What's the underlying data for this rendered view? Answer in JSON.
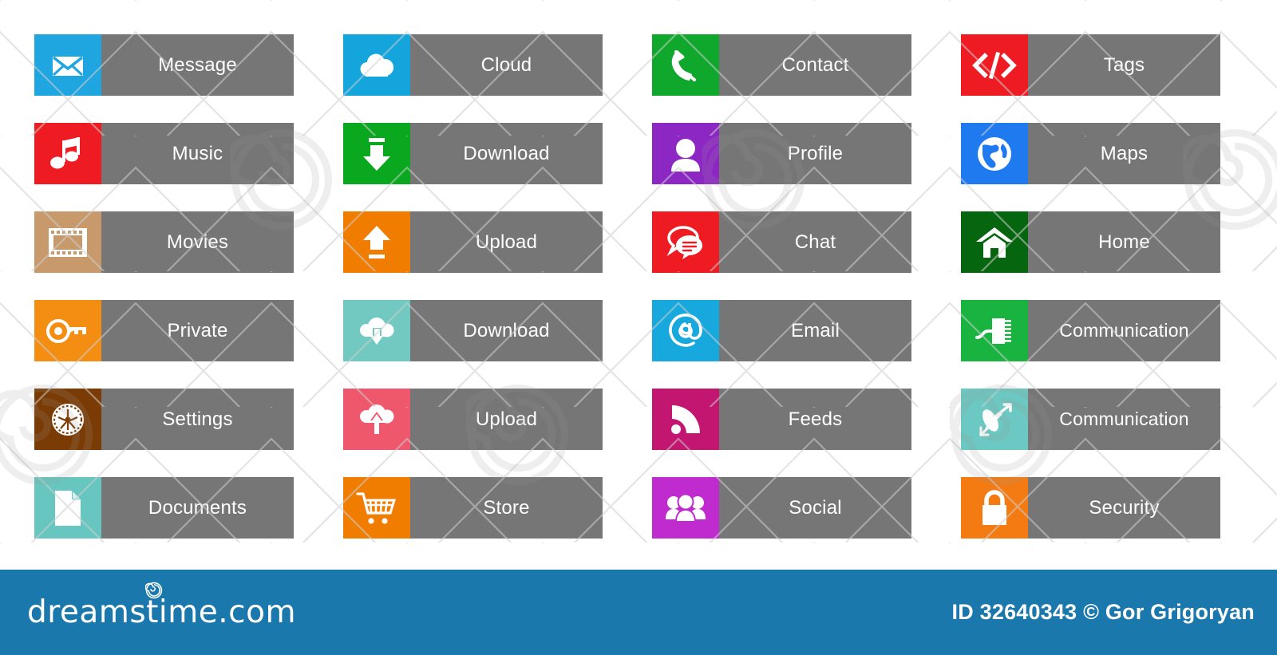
{
  "canvas": {
    "background": "#ffffff",
    "tile_label_background": "#767676",
    "tile_label_color": "#ffffff"
  },
  "tiles": [
    {
      "label": "Message",
      "icon": "envelope-icon",
      "color": "#1fa5e0",
      "icon_color": "#ffffff"
    },
    {
      "label": "Cloud",
      "icon": "cloud-icon",
      "color": "#13a5dc",
      "icon_color": "#ffffff"
    },
    {
      "label": "Contact",
      "icon": "phone-handset-icon",
      "color": "#10a82c",
      "icon_color": "#ffffff"
    },
    {
      "label": "Tags",
      "icon": "code-tag-icon",
      "color": "#ee1c22",
      "icon_color": "#ffffff"
    },
    {
      "label": "Music",
      "icon": "music-note-icon",
      "color": "#ee1c22",
      "icon_color": "#ffffff"
    },
    {
      "label": "Download",
      "icon": "download-arrow-icon",
      "color": "#0aa81e",
      "icon_color": "#ffffff"
    },
    {
      "label": "Profile",
      "icon": "user-avatar-icon",
      "color": "#8d27c4",
      "icon_color": "#ffffff"
    },
    {
      "label": "Maps",
      "icon": "globe-icon",
      "color": "#1f7af0",
      "icon_color": "#ffffff"
    },
    {
      "label": "Movies",
      "icon": "film-strip-icon",
      "color": "#c89a6b",
      "icon_color": "#ffffff"
    },
    {
      "label": "Upload",
      "icon": "upload-arrow-icon",
      "color": "#f07c00",
      "icon_color": "#ffffff"
    },
    {
      "label": "Chat",
      "icon": "chat-bubbles-icon",
      "color": "#ee1c22",
      "icon_color": "#ffffff"
    },
    {
      "label": "Home",
      "icon": "house-icon",
      "color": "#06660f",
      "icon_color": "#ffffff"
    },
    {
      "label": "Private",
      "icon": "key-icon",
      "color": "#f48e12",
      "icon_color": "#ffffff"
    },
    {
      "label": "Download",
      "icon": "cloud-download-icon",
      "color": "#72c9c2",
      "icon_color": "#ffffff"
    },
    {
      "label": "Email",
      "icon": "at-sign-icon",
      "color": "#17a9dd",
      "icon_color": "#ffffff"
    },
    {
      "label": "Communication",
      "icon": "circuit-chip-icon",
      "color": "#19b33f",
      "icon_color": "#ffffff"
    },
    {
      "label": "Settings",
      "icon": "gear-icon",
      "color": "#7a3c04",
      "icon_color": "#ffffff"
    },
    {
      "label": "Upload",
      "icon": "cloud-upload-icon",
      "color": "#ef576c",
      "icon_color": "#ffffff"
    },
    {
      "label": "Feeds",
      "icon": "rss-feed-icon",
      "color": "#c21670",
      "icon_color": "#ffffff"
    },
    {
      "label": "Communication",
      "icon": "satellite-dish-icon",
      "color": "#6cc8c2",
      "icon_color": "#ffffff"
    },
    {
      "label": "Documents",
      "icon": "document-page-icon",
      "color": "#68c6c0",
      "icon_color": "#ffffff"
    },
    {
      "label": "Store",
      "icon": "shopping-cart-icon",
      "color": "#f07c00",
      "icon_color": "#ffffff"
    },
    {
      "label": "Social",
      "icon": "group-people-icon",
      "color": "#bf2bce",
      "icon_color": "#ffffff"
    },
    {
      "label": "Security",
      "icon": "padlock-icon",
      "color": "#f47b12",
      "icon_color": "#ffffff"
    }
  ],
  "footer": {
    "background": "#1b78ad",
    "brand": "dreamstime.com",
    "brand_mark": "spiral-logo-icon",
    "credit": "ID 32640343 © Gor Grigoryan"
  }
}
